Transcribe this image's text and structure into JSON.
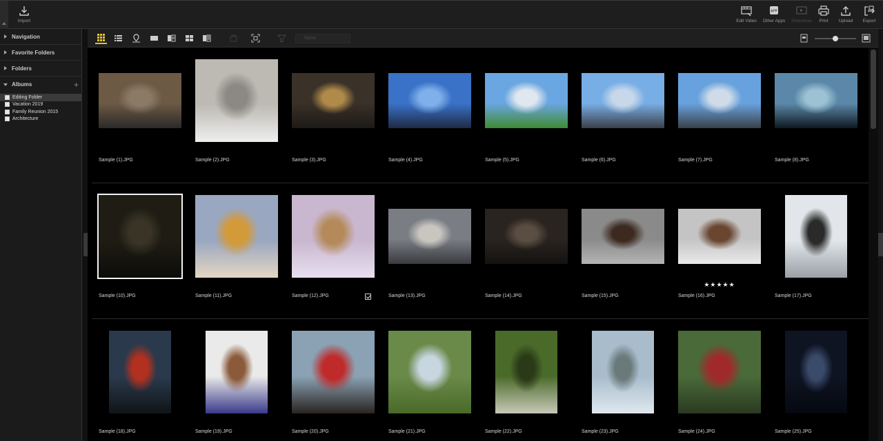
{
  "topbar": {
    "import_label": "Import",
    "right_buttons": [
      {
        "name": "edit-video-button",
        "icon": "film-edit-icon",
        "label": "Edit Video",
        "enabled": true
      },
      {
        "name": "other-apps-button",
        "icon": "apps-icon",
        "label": "Other Apps",
        "enabled": true
      },
      {
        "name": "slideshow-button",
        "icon": "slideshow-icon",
        "label": "Slideshow",
        "enabled": false
      },
      {
        "name": "print-button",
        "icon": "printer-icon",
        "label": "Print",
        "enabled": true
      },
      {
        "name": "upload-button",
        "icon": "upload-icon",
        "label": "Upload",
        "enabled": true
      },
      {
        "name": "export-button",
        "icon": "export-icon",
        "label": "Export",
        "enabled": true
      }
    ]
  },
  "sidebar": {
    "sections": {
      "navigation": "Navigation",
      "favorite_folders": "Favorite Folders",
      "folders": "Folders",
      "albums": "Albums"
    },
    "albums": [
      {
        "label": "Editing Folder",
        "selected": true
      },
      {
        "label": "Vacation 2019",
        "selected": false
      },
      {
        "label": "Family Reunion 2015",
        "selected": false
      },
      {
        "label": "Architecture",
        "selected": false
      }
    ]
  },
  "toolbar": {
    "view_modes": [
      "thumbnail-grid-icon",
      "list-view-icon",
      "map-pin-icon",
      "single-image-icon",
      "compare-icon",
      "multi-view-icon",
      "split-view-icon"
    ],
    "active_view": "thumbnail-grid-icon",
    "filter_placeholder": "None",
    "zoom_level": 0.5
  },
  "accent_color": "#e6c22e",
  "thumbnails": [
    {
      "caption": "Sample (1).JPG",
      "orientation": "landscape",
      "colors": [
        "#6d5a45",
        "#8a7a66",
        "#2a2a2a"
      ]
    },
    {
      "caption": "Sample (2).JPG",
      "orientation": "portrait-wide",
      "colors": [
        "#bdbab3",
        "#8c8883",
        "#efefef"
      ]
    },
    {
      "caption": "Sample (3).JPG",
      "orientation": "landscape",
      "colors": [
        "#3a3128",
        "#b08a4a",
        "#1d1a17"
      ]
    },
    {
      "caption": "Sample (4).JPG",
      "orientation": "landscape",
      "colors": [
        "#3a72c8",
        "#7fb0ea",
        "#1e2a44"
      ]
    },
    {
      "caption": "Sample (5).JPG",
      "orientation": "landscape",
      "colors": [
        "#6aa6e2",
        "#dfe7ef",
        "#3f8a32"
      ]
    },
    {
      "caption": "Sample (6).JPG",
      "orientation": "landscape",
      "colors": [
        "#78aee6",
        "#c8d8ea",
        "#3b3f48"
      ]
    },
    {
      "caption": "Sample (7).JPG",
      "orientation": "landscape",
      "colors": [
        "#68a2de",
        "#cfdbe8",
        "#39404a"
      ]
    },
    {
      "caption": "Sample (8).JPG",
      "orientation": "landscape",
      "colors": [
        "#5b88a8",
        "#9cc2d4",
        "#0e1820"
      ]
    },
    {
      "caption": "Sample (10).JPG",
      "orientation": "landscape-tall",
      "colors": [
        "#1f1c14",
        "#3a3426",
        "#0d0c09"
      ],
      "selected": true
    },
    {
      "caption": "Sample (11).JPG",
      "orientation": "landscape-tall",
      "colors": [
        "#9aa7c0",
        "#d39a3a",
        "#e4d6c2"
      ]
    },
    {
      "caption": "Sample (12).JPG",
      "orientation": "landscape-tall",
      "colors": [
        "#c9b7cf",
        "#b48a5a",
        "#e9dff0"
      ],
      "checked": true
    },
    {
      "caption": "Sample (13).JPG",
      "orientation": "landscape",
      "colors": [
        "#7a7d84",
        "#c9c6c0",
        "#3a3b3f"
      ]
    },
    {
      "caption": "Sample (14).JPG",
      "orientation": "landscape",
      "colors": [
        "#2a2420",
        "#5a4d42",
        "#141210"
      ]
    },
    {
      "caption": "Sample (15).JPG",
      "orientation": "landscape",
      "colors": [
        "#8a8a8a",
        "#3c2a20",
        "#b4b4b4"
      ]
    },
    {
      "caption": "Sample (16).JPG",
      "orientation": "landscape",
      "colors": [
        "#c4c4c4",
        "#6a4630",
        "#eaeaea"
      ],
      "rating": "★★★★★"
    },
    {
      "caption": "Sample (17).JPG",
      "orientation": "portrait",
      "colors": [
        "#e2e6ea",
        "#2a2a2a",
        "#9aa0a6"
      ]
    },
    {
      "caption": "Sample (18).JPG",
      "orientation": "portrait",
      "colors": [
        "#2a3a4c",
        "#b23020",
        "#101418"
      ]
    },
    {
      "caption": "Sample (19).JPG",
      "orientation": "portrait",
      "colors": [
        "#eaeaea",
        "#8a5a3a",
        "#3a3a8a"
      ]
    },
    {
      "caption": "Sample (20).JPG",
      "orientation": "landscape-tall",
      "colors": [
        "#8aa2b4",
        "#c02a2a",
        "#2a2420"
      ]
    },
    {
      "caption": "Sample (21).JPG",
      "orientation": "landscape-tall",
      "colors": [
        "#6a8a4a",
        "#c8d6e0",
        "#4a6a2a"
      ]
    },
    {
      "caption": "Sample (22).JPG",
      "orientation": "portrait",
      "colors": [
        "#4a6a2a",
        "#2a3a18",
        "#c8c8b8"
      ]
    },
    {
      "caption": "Sample (23).JPG",
      "orientation": "portrait",
      "colors": [
        "#a8bccc",
        "#6a7a7a",
        "#dfe8ee"
      ]
    },
    {
      "caption": "Sample (24).JPG",
      "orientation": "landscape-tall",
      "colors": [
        "#4a6a3a",
        "#a02a2a",
        "#2a3a20"
      ]
    },
    {
      "caption": "Sample (25).JPG",
      "orientation": "portrait",
      "colors": [
        "#0e1422",
        "#3a4a6a",
        "#050810"
      ]
    }
  ]
}
